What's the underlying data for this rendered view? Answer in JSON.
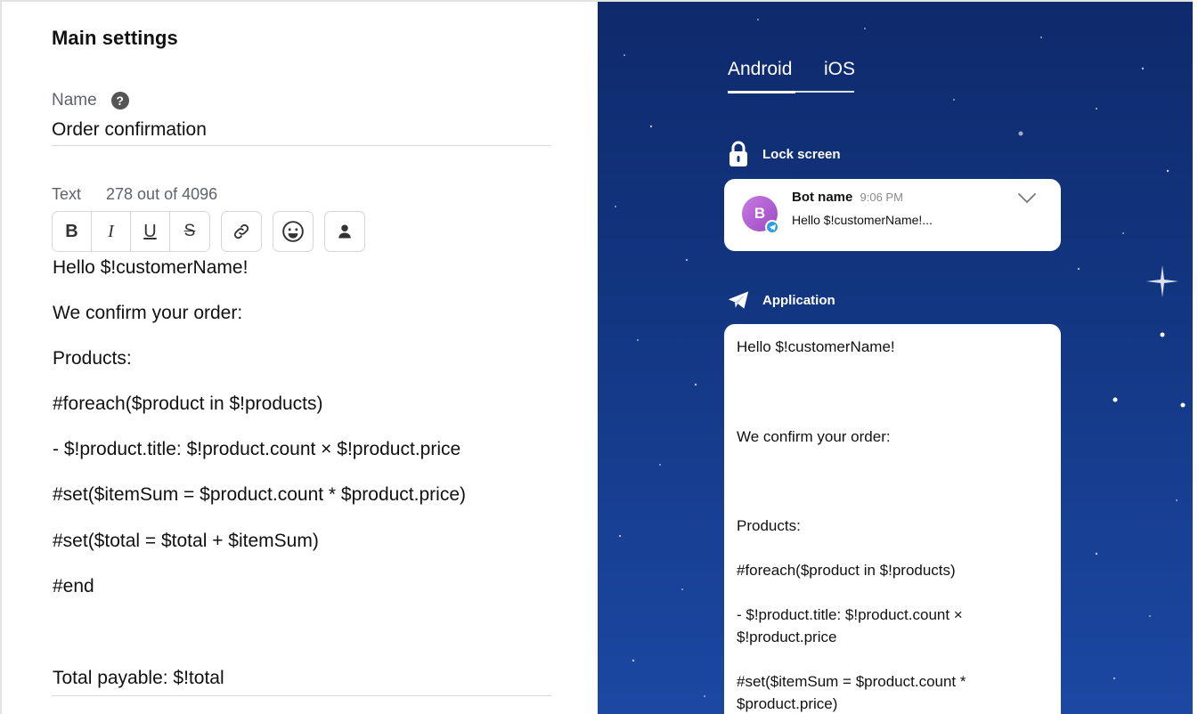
{
  "main_settings": {
    "title": "Main settings",
    "name_label": "Name",
    "help_icon": "question-circle-icon",
    "name_value": "Order confirmation",
    "text_label": "Text",
    "char_count": "278 out of 4096"
  },
  "toolbar": {
    "bold": "B",
    "italic": "I",
    "underline": "U",
    "strike": "S",
    "link_icon": "link-icon",
    "emoji_icon": "emoji-icon",
    "person_icon": "person-icon"
  },
  "editor": {
    "lines": [
      "Hello $!customerName!",
      "We confirm your order:",
      "Products:",
      "#foreach($product in $!products)",
      "- $!product.title: $!product.count × $!product.price",
      "#set($itemSum = $product.count * $product.price)",
      "#set($total = $total + $itemSum)",
      "#end",
      "Total payable: $!total"
    ]
  },
  "preview": {
    "tabs": [
      "Android",
      "iOS"
    ],
    "active_tab": "Android",
    "lock_screen_label": "Lock screen",
    "application_label": "Application",
    "notification": {
      "avatar_letter": "B",
      "bot_name": "Bot name",
      "time": "9:06 PM",
      "text": "Hello $!customerName!..."
    },
    "message_lines": [
      "Hello $!customerName!",
      "We confirm your order:",
      "Products:",
      "#foreach($product in $!products)",
      "- $!product.title: $!product.count ×",
      "$!product.price",
      "#set($itemSum = $product.count *",
      "$product.price)"
    ]
  },
  "colors": {
    "preview_bg_top": "#0f2a6c",
    "preview_bg_bottom": "#1c48a3",
    "telegram_blue": "#2ba0e0",
    "avatar_purple": "#b060d4"
  }
}
